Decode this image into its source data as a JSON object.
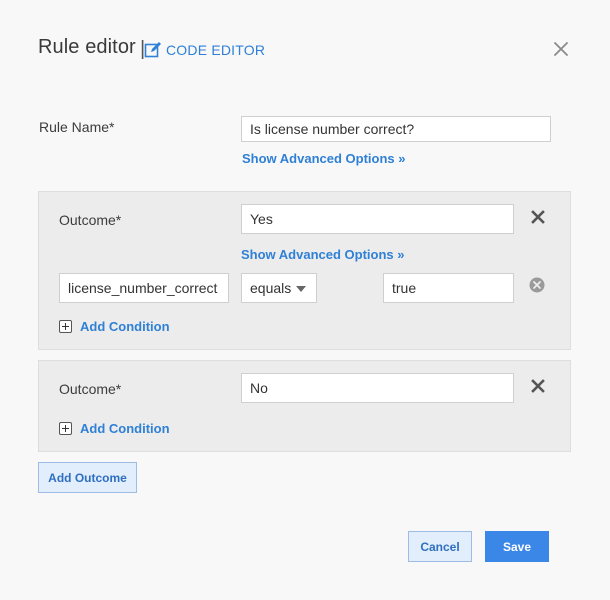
{
  "dialog": {
    "title": "Rule editor",
    "separator": "|",
    "code_editor_label": "CODE EDITOR"
  },
  "rule": {
    "name_label": "Rule Name*",
    "name_value": "Is license number correct?",
    "show_advanced": "Show Advanced Options »"
  },
  "outcomes": [
    {
      "label": "Outcome*",
      "value": "Yes",
      "show_advanced": "Show Advanced Options »",
      "condition": {
        "field": "license_number_correct",
        "operator": "equals",
        "value": "true"
      },
      "add_condition": "Add Condition"
    },
    {
      "label": "Outcome*",
      "value": "No",
      "add_condition": "Add Condition"
    }
  ],
  "actions": {
    "add_outcome": "Add Outcome",
    "cancel": "Cancel",
    "save": "Save"
  },
  "colors": {
    "link": "#2f80d6",
    "primary": "#3b87e8",
    "panel": "#ececec"
  }
}
